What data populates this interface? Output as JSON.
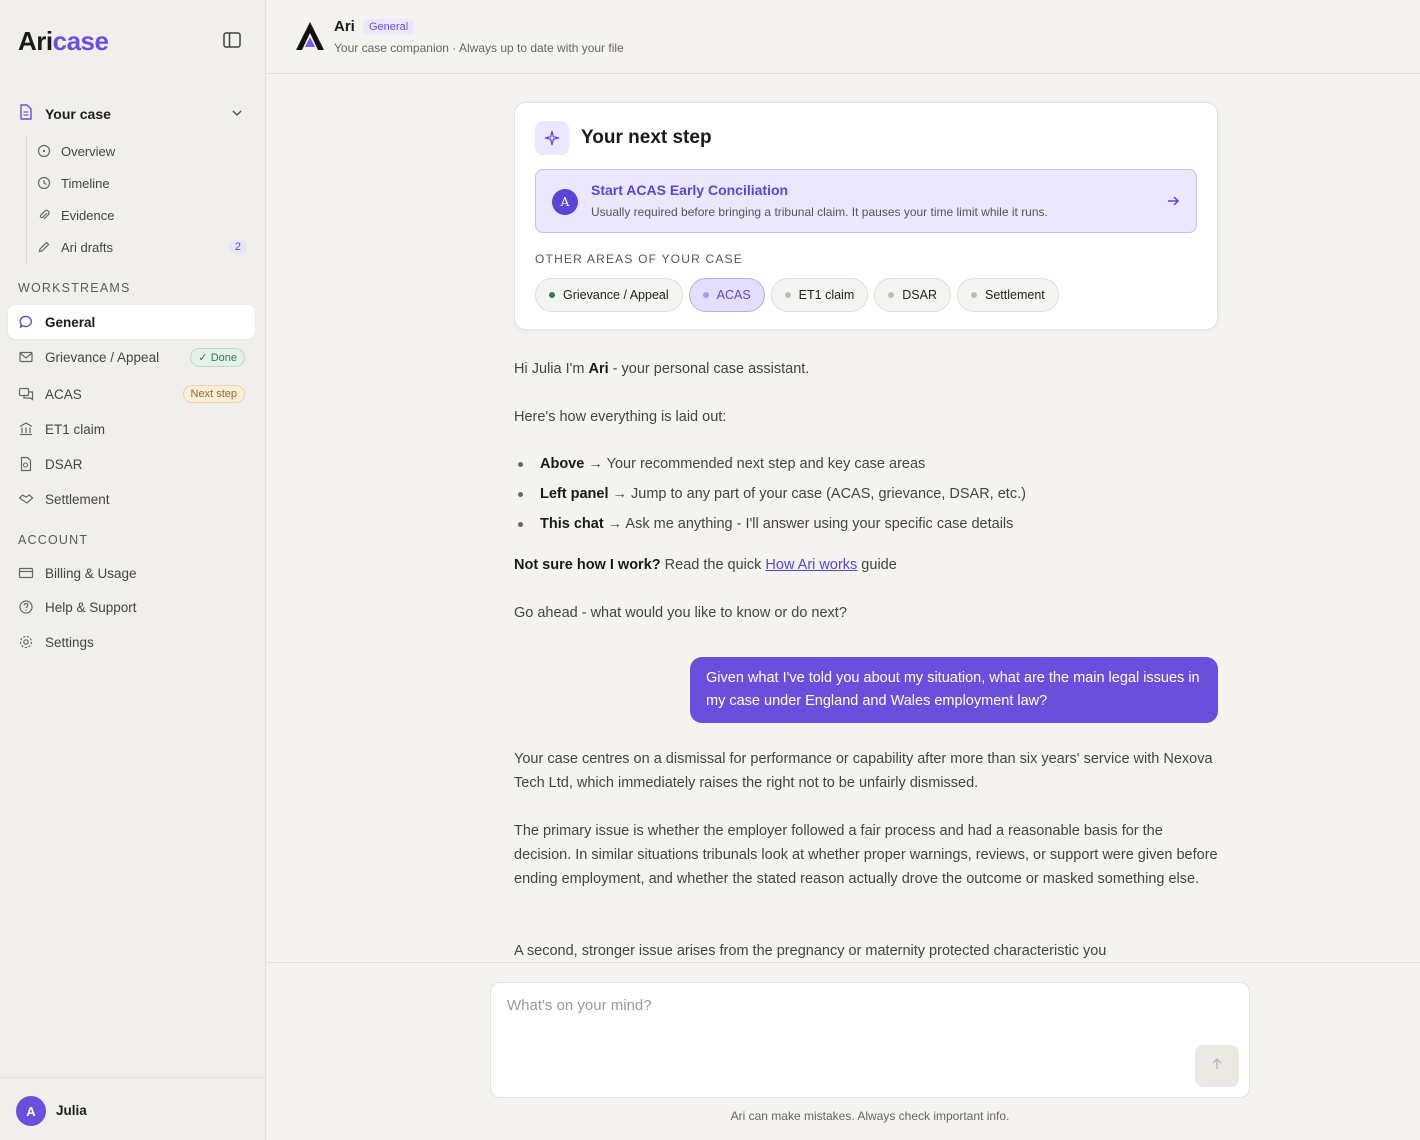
{
  "brand": {
    "part1": "Ari",
    "part2": "case"
  },
  "sidebar": {
    "case_label": "Your case",
    "case_items": [
      {
        "label": "Overview"
      },
      {
        "label": "Timeline"
      },
      {
        "label": "Evidence"
      },
      {
        "label": "Ari drafts",
        "count": "2"
      }
    ],
    "workstreams_heading": "WORKSTREAMS",
    "workstreams": [
      {
        "label": "General"
      },
      {
        "label": "Grievance / Appeal",
        "badge": "Done"
      },
      {
        "label": "ACAS",
        "badge": "Next step"
      },
      {
        "label": "ET1 claim"
      },
      {
        "label": "DSAR"
      },
      {
        "label": "Settlement"
      }
    ],
    "account_heading": "ACCOUNT",
    "account": [
      {
        "label": "Billing & Usage"
      },
      {
        "label": "Help & Support"
      },
      {
        "label": "Settings"
      }
    ],
    "user": {
      "initial": "A",
      "name": "Julia"
    }
  },
  "header": {
    "title": "Ari",
    "tag": "General",
    "subtitle": "Your case companion · Always up to date with your file"
  },
  "next_step": {
    "title": "Your next step",
    "avatar": "A",
    "step_title": "Start ACAS Early Conciliation",
    "step_desc": "Usually required before bringing a tribunal claim. It pauses your time limit while it runs.",
    "areas_label": "OTHER AREAS OF YOUR CASE",
    "chips": [
      {
        "label": "Grievance / Appeal"
      },
      {
        "label": "ACAS"
      },
      {
        "label": "ET1 claim"
      },
      {
        "label": "DSAR"
      },
      {
        "label": "Settlement"
      }
    ]
  },
  "chat": {
    "greeting_pre": "Hi Julia I'm ",
    "greeting_name": "Ari",
    "greeting_post": " - your personal case assistant.",
    "layout_intro": "Here's how everything is laid out:",
    "bullets": [
      {
        "bold": "Above",
        "text": " → Your recommended next step and key case areas"
      },
      {
        "bold": "Left panel",
        "text": " → Jump to any part of your case (ACAS, grievance, DSAR, etc.)"
      },
      {
        "bold": "This chat",
        "text": " → Ask me anything - I'll answer using your specific case details"
      }
    ],
    "notsure_bold": "Not sure how I work?",
    "notsure_pre": " Read the quick ",
    "notsure_link": "How Ari works",
    "notsure_post": " guide",
    "goahead": "Go ahead - what would you like to know or do next?",
    "user_message": "Given what I've told you about my situation, what are the main legal issues in my case under England and Wales employment law?",
    "reply_p1": "Your case centres on a dismissal for performance or capability after more than six years' service with Nexova Tech Ltd, which immediately raises the right not to be unfairly dismissed.",
    "reply_p2": "The primary issue is whether the employer followed a fair process and had a reasonable basis for the decision. In similar situations tribunals look at whether proper warnings, reviews, or support were given before ending employment, and whether the stated reason actually drove the outcome or masked something else.",
    "reply_p3": "A second, stronger issue arises from the pregnancy or maternity protected characteristic you"
  },
  "composer": {
    "placeholder": "What's on your mind?",
    "disclaimer": "Ari can make mistakes. Always check important info."
  },
  "colors": {
    "accent": "#6a4fdc",
    "done": "#2f7a55",
    "next": "#a0651a"
  }
}
